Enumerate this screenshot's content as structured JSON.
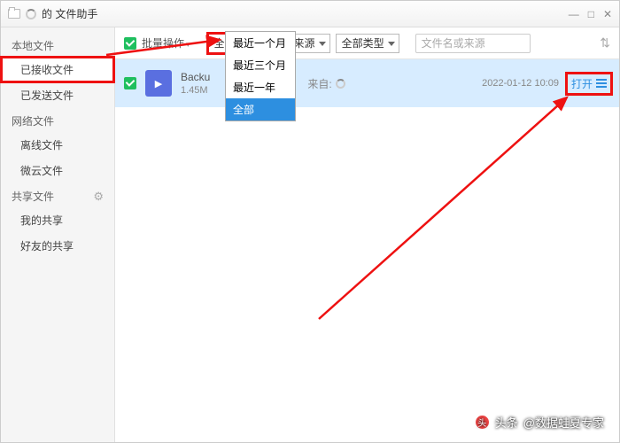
{
  "titlebar": {
    "title": "的 文件助手"
  },
  "win_controls": {
    "min": "—",
    "max": "□",
    "close": "✕"
  },
  "sidebar": {
    "group_local": "本地文件",
    "item_received": "已接收文件",
    "item_sent": "已发送文件",
    "group_net": "网络文件",
    "item_offline": "离线文件",
    "item_weiyun": "微云文件",
    "group_share": "共享文件",
    "item_myshare": "我的共享",
    "item_friendshare": "好友的共享"
  },
  "toolbar": {
    "batch": "批量操作",
    "dd_time": "全部",
    "dd_source": "全部来源",
    "dd_type": "全部类型",
    "search_ph": "文件名或来源"
  },
  "dd_menu": {
    "m1": "最近一个月",
    "m2": "最近三个月",
    "m3": "最近一年",
    "m4": "全部"
  },
  "file": {
    "name": "Backu",
    "ext": "t",
    "size": "1.45M",
    "from_label": "来自:",
    "date": "2022-01-12 10:09",
    "open": "打开"
  },
  "watermark": {
    "prefix": "头条",
    "author": "@数据蛙夏专家"
  }
}
